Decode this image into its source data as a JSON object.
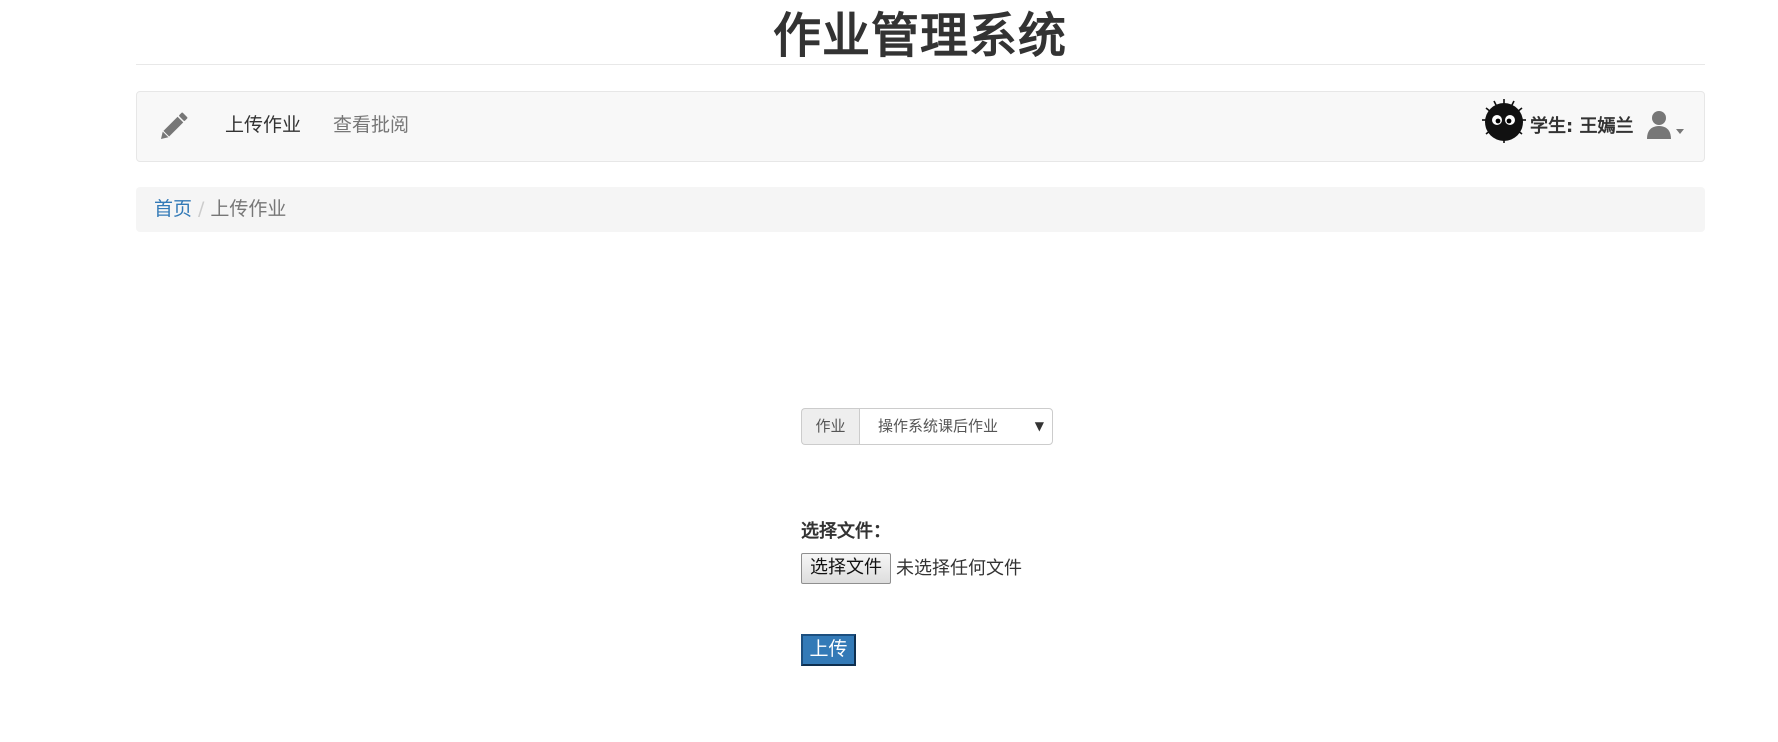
{
  "header": {
    "title": "作业管理系统"
  },
  "navbar": {
    "brand_icon": "pencil-icon",
    "links": [
      {
        "label": "上传作业",
        "active": true
      },
      {
        "label": "查看批阅",
        "active": false
      }
    ],
    "user": {
      "avatar": "soot-sprite-avatar",
      "label": "学生: 王嫣兰",
      "menu_icon": "user-icon"
    }
  },
  "breadcrumb": {
    "home": "首页",
    "separator": "/",
    "current": "上传作业"
  },
  "form": {
    "assignment_addon": "作业",
    "assignment_selected": "操作系统课后作业",
    "file_label": "选择文件：",
    "file_button": "选择文件",
    "file_status": "未选择任何文件",
    "submit_label": "上传"
  },
  "colors": {
    "link": "#337ab7",
    "submit_bg": "#337ab7",
    "navbar_bg": "#f8f8f8",
    "breadcrumb_bg": "#f5f5f5"
  }
}
